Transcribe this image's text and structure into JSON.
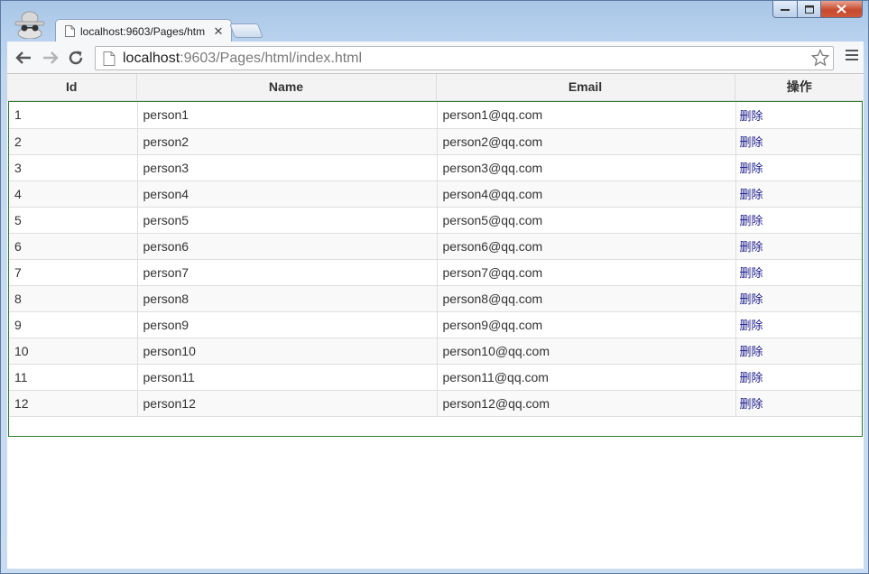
{
  "browser": {
    "tab_title": "localhost:9603/Pages/htm",
    "tab_close": "✕",
    "url_host": "localhost",
    "url_rest": ":9603/Pages/html/index.html"
  },
  "table": {
    "columns": [
      "Id",
      "Name",
      "Email",
      "操作"
    ],
    "rows": [
      {
        "id": "1",
        "name": "person1",
        "email": "person1@qq.com",
        "action": "删除"
      },
      {
        "id": "2",
        "name": "person2",
        "email": "person2@qq.com",
        "action": "删除"
      },
      {
        "id": "3",
        "name": "person3",
        "email": "person3@qq.com",
        "action": "删除"
      },
      {
        "id": "4",
        "name": "person4",
        "email": "person4@qq.com",
        "action": "删除"
      },
      {
        "id": "5",
        "name": "person5",
        "email": "person5@qq.com",
        "action": "删除"
      },
      {
        "id": "6",
        "name": "person6",
        "email": "person6@qq.com",
        "action": "删除"
      },
      {
        "id": "7",
        "name": "person7",
        "email": "person7@qq.com",
        "action": "删除"
      },
      {
        "id": "8",
        "name": "person8",
        "email": "person8@qq.com",
        "action": "删除"
      },
      {
        "id": "9",
        "name": "person9",
        "email": "person9@qq.com",
        "action": "删除"
      },
      {
        "id": "10",
        "name": "person10",
        "email": "person10@qq.com",
        "action": "删除"
      },
      {
        "id": "11",
        "name": "person11",
        "email": "person11@qq.com",
        "action": "删除"
      },
      {
        "id": "12",
        "name": "person12",
        "email": "person12@qq.com",
        "action": "删除"
      }
    ]
  },
  "colors": {
    "frame_border": "#2f7a2f",
    "link": "#1a1a8c"
  },
  "icons": [
    "incognito-icon",
    "page-icon",
    "back-arrow-icon",
    "forward-arrow-icon",
    "reload-icon",
    "star-icon",
    "menu-icon",
    "close-icon",
    "minimize-icon",
    "maximize-icon"
  ]
}
